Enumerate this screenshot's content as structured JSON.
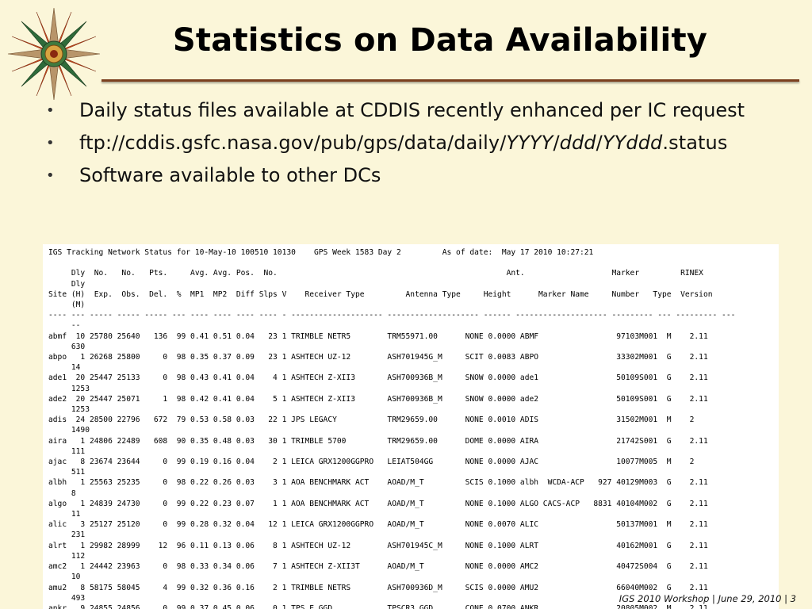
{
  "slide": {
    "title": "Statistics on Data Availability",
    "bullets": {
      "b1": "Daily status files available at CDDIS recently enhanced per IC request",
      "b2_prefix": "ftp://cddis.gsfc.nasa.gov/pub/gps/data/daily/",
      "b2_yyyy": "YYYY",
      "b2_sep1": "/",
      "b2_ddd": "ddd",
      "b2_sep2": "/",
      "b2_yyddd": "YYddd",
      "b2_suffix": ".status",
      "b3": "Software available to other DCs"
    },
    "footer": "IGS 2010 Workshop | June 29, 2010 | 3",
    "accent_color": "#7b3f1e",
    "background_color": "#fbf6d9",
    "logo_icon": "compass-rose-icon"
  },
  "status_table": {
    "text": "IGS Tracking Network Status for 10-May-10 100510 10130    GPS Week 1583 Day 2         As of date:  May 17 2010 10:27:21\n\n     Dly  No.   No.   Pts.     Avg. Avg. Pos.  No.                                                  Ant.                   Marker         RINEX\n     Dly\nSite (H)  Exp.  Obs.  Del.  %  MP1  MP2  Diff Slps V    Receiver Type         Antenna Type     Height      Marker Name     Number   Type  Version\n     (M)\n---- --- ----- ----- ----- --- ---- ---- ---- ---- - -------------------- -------------------- ------ -------------------- --------- --- --------- ---\n     --\nabmf  10 25780 25640   136  99 0.41 0.51 0.04   23 1 TRIMBLE NETR5        TRM55971.00      NONE 0.0000 ABMF                 97103M001  M    2.11\n     630\nabpo   1 26268 25800     0  98 0.35 0.37 0.09   23 1 ASHTECH UZ-12        ASH701945G_M     SCIT 0.0083 ABPO                 33302M001  G    2.11\n     14\nade1  20 25447 25133     0  98 0.43 0.41 0.04    4 1 ASHTECH Z-XII3       ASH700936B_M     SNOW 0.0000 ade1                 50109S001  G    2.11\n     1253\nade2  20 25447 25071     1  98 0.42 0.41 0.04    5 1 ASHTECH Z-XII3       ASH700936B_M     SNOW 0.0000 ade2                 50109S001  G    2.11\n     1253\nadis  24 28500 22796   672  79 0.53 0.58 0.03   22 1 JPS LEGACY           TRM29659.00      NONE 0.0010 ADIS                 31502M001  M    2\n     1490\naira   1 24806 22489   608  90 0.35 0.48 0.03   30 1 TRIMBLE 5700         TRM29659.00      DOME 0.0000 AIRA                 21742S001  G    2.11\n     111\najac   8 23674 23644     0  99 0.19 0.16 0.04    2 1 LEICA GRX1200GGPRO   LEIAT504GG       NONE 0.0000 AJAC                 10077M005  M    2\n     511\nalbh   1 25563 25235     0  98 0.22 0.26 0.03    3 1 AOA BENCHMARK ACT    AOAD/M_T         SCIS 0.1000 albh  WCDA-ACP   927 40129M003  G    2.11\n     8\nalgo   1 24839 24730     0  99 0.22 0.23 0.07    1 1 AOA BENCHMARK ACT    AOAD/M_T         NONE 0.1000 ALGO CACS-ACP   8831 40104M002  G    2.11\n     11\nalic   3 25127 25120     0  99 0.28 0.32 0.04   12 1 LEICA GRX1200GGPRO   AOAD/M_T         NONE 0.0070 ALIC                 50137M001  M    2.11\n     231\nalrt   1 29982 28999    12  96 0.11 0.13 0.06    8 1 ASHTECH UZ-12        ASH701945C_M     NONE 0.1000 ALRT                 40162M001  G    2.11\n     112\namc2   1 24442 23963     0  98 0.33 0.34 0.06    7 1 ASHTECH Z-XII3T      AOAD/M_T         NONE 0.0000 AMC2                 40472S004  G    2.11\n     10\namu2   8 58175 58045     4  99 0.32 0.36 0.16    2 1 TRIMBLE NETRS        ASH700936D_M     SCIS 0.0000 AMU2                 66040M002  G    2.11\n     493\nankr   9 24855 24856     0  99 0.37 0.45 0.06    0 1 TPS E_GGD            TPSCR3_GGD       CONE 0.0700 ANKR                 20805M002  M    2.11"
  }
}
